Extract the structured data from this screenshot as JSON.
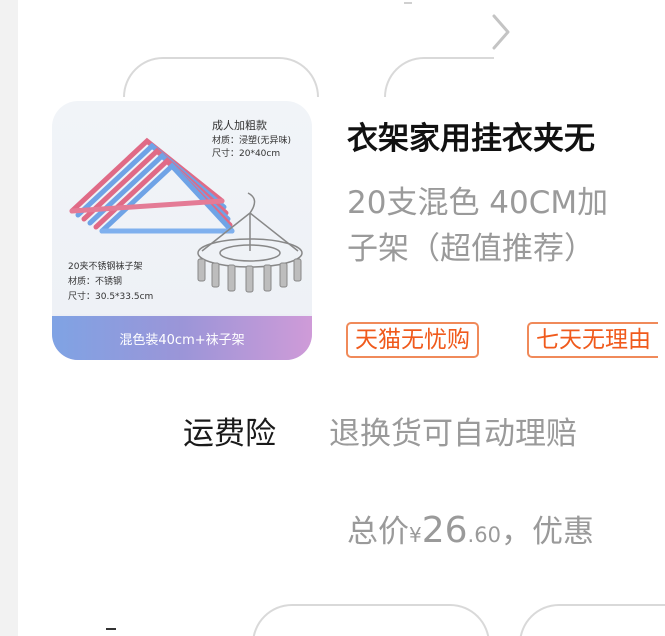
{
  "product": {
    "title": "衣架家用挂衣夹无",
    "subtitle_line1": "20支混色 40CM加",
    "subtitle_line2": "子架（超值推荐）",
    "image": {
      "heading": "成人加粗款",
      "material_1": "材质：浸塑(无异味)",
      "size_1": "尺寸：20*40cm",
      "item_2": "20夹不锈钢袜子架",
      "material_2": "材质：不锈钢",
      "size_2": "尺寸：30.5*33.5cm",
      "banner": "混色装40cm+袜子架"
    },
    "badges": [
      "天猫无忧购",
      "七天无理由"
    ]
  },
  "insurance": {
    "label": "运费险",
    "description": "退换货可自动理赔"
  },
  "total": {
    "prefix": "总价",
    "currency": "¥",
    "integer": "26",
    "decimal": ".60",
    "suffix": "，优惠"
  },
  "colors": {
    "badge_orange": "#f05a1c",
    "text_gray": "#9a9a9a"
  },
  "icons": {
    "top_arrow": "chevron-right-icon"
  }
}
